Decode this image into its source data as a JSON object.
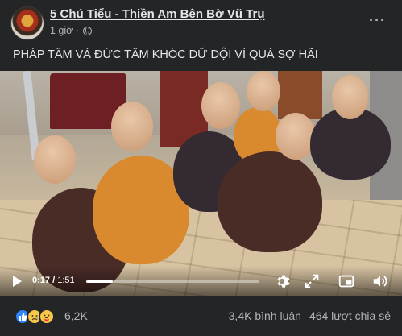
{
  "post": {
    "author": "5 Chú Tiểu - Thiền Am Bên Bờ Vũ Trụ",
    "time": "1 giờ",
    "separator": "·",
    "more": "···",
    "caption": "PHÁP TÂM VÀ ĐỨC TÂM KHÓC DỮ DỘI VÌ QUÁ SỢ HÃI"
  },
  "video": {
    "current_time": "0:17",
    "time_separator": " / ",
    "duration": "1:51",
    "progress": 0.153
  },
  "footer": {
    "reactions_count": "6,2K",
    "comments": "3,4K bình luận",
    "shares": "464 lượt chia sẻ"
  },
  "icons": {
    "play": "play-icon",
    "settings": "gear-icon",
    "fullscreen": "fullscreen-icon",
    "pip": "picture-in-picture-icon",
    "volume": "volume-icon",
    "visibility": "globe-icon"
  },
  "colors": {
    "background": "#242526",
    "text": "#e4e6eb",
    "secondary": "#b0b3b8",
    "like": "#2d86ff",
    "emoji": "#f7c948"
  }
}
